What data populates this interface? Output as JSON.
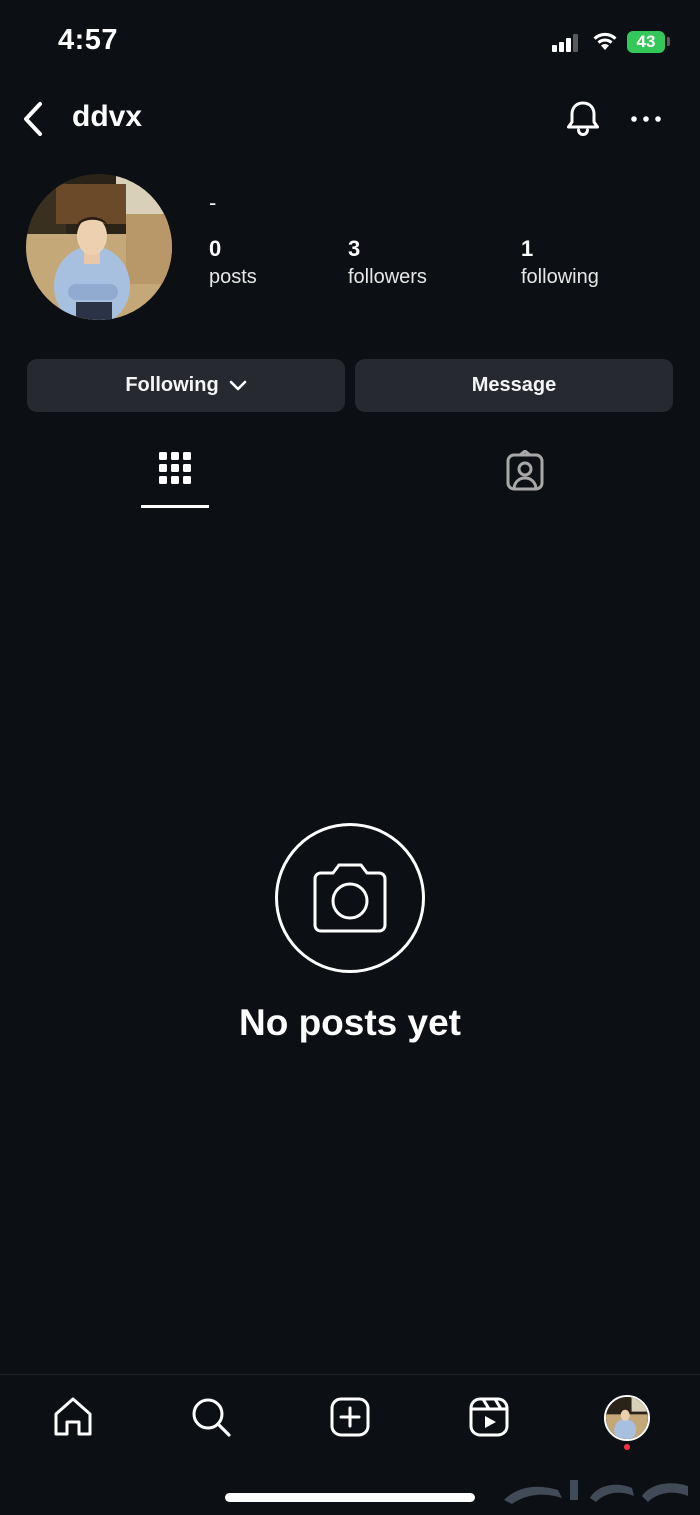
{
  "status_bar": {
    "time": "4:57",
    "battery": "43",
    "icons": [
      "signal-icon",
      "wifi-icon",
      "battery-icon"
    ]
  },
  "header": {
    "username": "ddvx",
    "icons": [
      "back-chevron-icon",
      "bell-icon",
      "more-horizontal-icon"
    ]
  },
  "profile": {
    "bio": "-",
    "stats": {
      "posts": {
        "value": "0",
        "label": "posts"
      },
      "followers": {
        "value": "3",
        "label": "followers"
      },
      "following": {
        "value": "1",
        "label": "following"
      }
    }
  },
  "actions": {
    "following_label": "Following",
    "message_label": "Message"
  },
  "tabs": [
    {
      "icon": "grid-icon",
      "active": true
    },
    {
      "icon": "tagged-person-icon",
      "active": false
    }
  ],
  "empty_state": {
    "icon": "camera-icon",
    "title": "No posts yet"
  },
  "bottom_nav": [
    {
      "icon": "home-icon"
    },
    {
      "icon": "search-icon"
    },
    {
      "icon": "create-plus-icon"
    },
    {
      "icon": "reels-icon"
    },
    {
      "icon": "profile-avatar"
    }
  ],
  "colors": {
    "background": "#0c1014",
    "button": "#262a30",
    "battery": "#34c759",
    "notification_dot": "#ff3040"
  }
}
